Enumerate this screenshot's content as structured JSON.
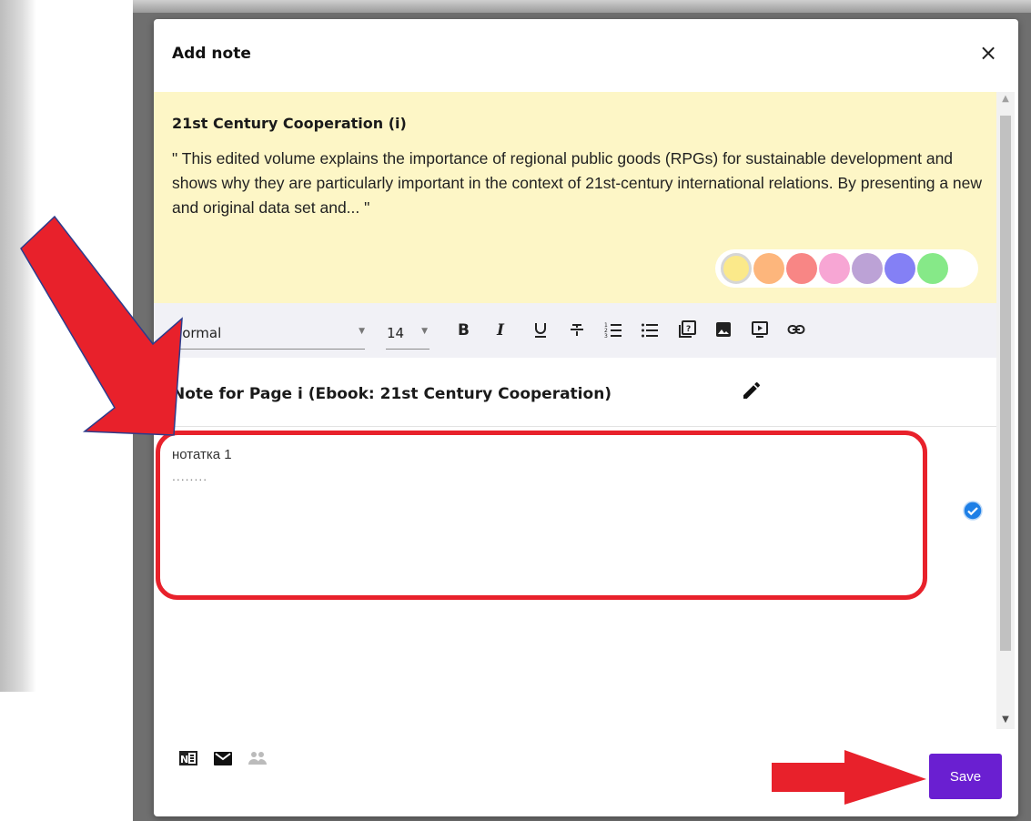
{
  "dialog": {
    "title": "Add note",
    "close_label": "×"
  },
  "quote": {
    "title": "21st Century Cooperation (i)",
    "text": "\" This edited volume explains the importance of regional public goods (RPGs) for sustainable development and shows why they are particularly important in the context of 21st-century international relations. By presenting a new and original data set and... \""
  },
  "swatches": [
    "#fbe98a",
    "#fdb67c",
    "#f88685",
    "#f7a6d4",
    "#bca2d6",
    "#8480f5",
    "#86e988"
  ],
  "selected_swatch": "#fbe98a",
  "toolbar": {
    "format_value": "Normal",
    "size_value": "14",
    "buttons": [
      "bold-icon",
      "italic-icon",
      "underline-icon",
      "strikethrough-icon",
      "ordered-list-icon",
      "bullet-list-icon",
      "insert-field-icon",
      "image-icon",
      "video-icon",
      "link-icon"
    ]
  },
  "note": {
    "title": "Note for Page i (Ebook: 21st Century Cooperation)",
    "line1": "нотатка 1",
    "line2": "........"
  },
  "footer": {
    "icons": [
      "onenote-icon",
      "email-icon",
      "share-users-icon"
    ],
    "save_label": "Save"
  },
  "annotation_color": "#e8212b",
  "accent_color": "#6a1fd1"
}
